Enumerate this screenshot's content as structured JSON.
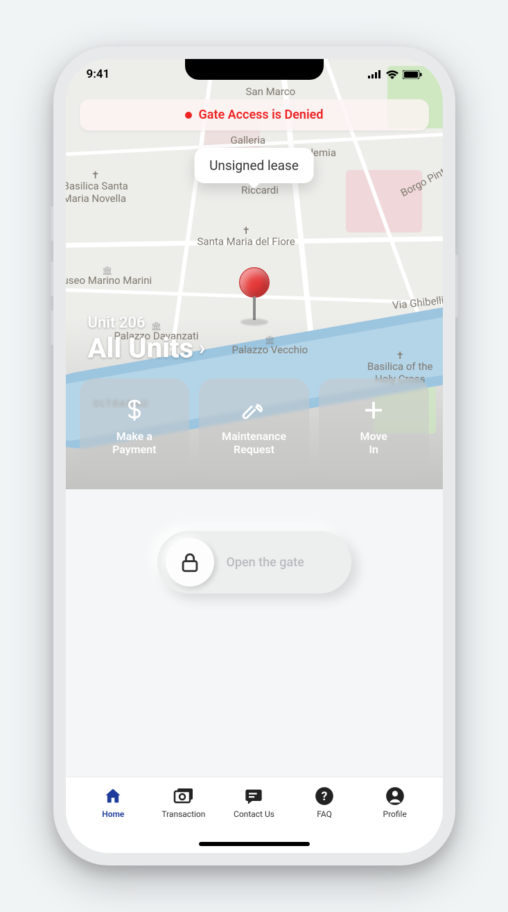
{
  "status": {
    "time": "9:41"
  },
  "banner": {
    "text": "Gate Access is Denied"
  },
  "tooltip": {
    "text": "Unsigned lease"
  },
  "unit": {
    "label": "Unit 206",
    "title": "All Units"
  },
  "actions": [
    {
      "label": "Make a\nPayment"
    },
    {
      "label": "Maintenance\nRequest"
    },
    {
      "label": "Move\nIn"
    }
  ],
  "gate": {
    "label": "Open the gate"
  },
  "tabs": [
    {
      "label": "Home"
    },
    {
      "label": "Transaction"
    },
    {
      "label": "Contact Us"
    },
    {
      "label": "FAQ"
    },
    {
      "label": "Profile"
    }
  ],
  "map_labels": {
    "san_marco": "San Marco",
    "galleria": "Galleria",
    "accademia": "dell'Accademia",
    "medici": "Palazzo Medici\nRiccardi",
    "novella": "Basilica Santa\nMaria Novella",
    "fiore": "Santa Maria del Fiore",
    "marini": "useo Marino Marini",
    "davanzati": "Palazzo Davanzati",
    "vecchio": "Palazzo Vecchio",
    "pinti": "Borgo Pinti",
    "ghibellina": "Via Ghibellin",
    "holycross": "Basilica of the\nHoly Cross",
    "oltrarno": "OLTRARNO"
  }
}
